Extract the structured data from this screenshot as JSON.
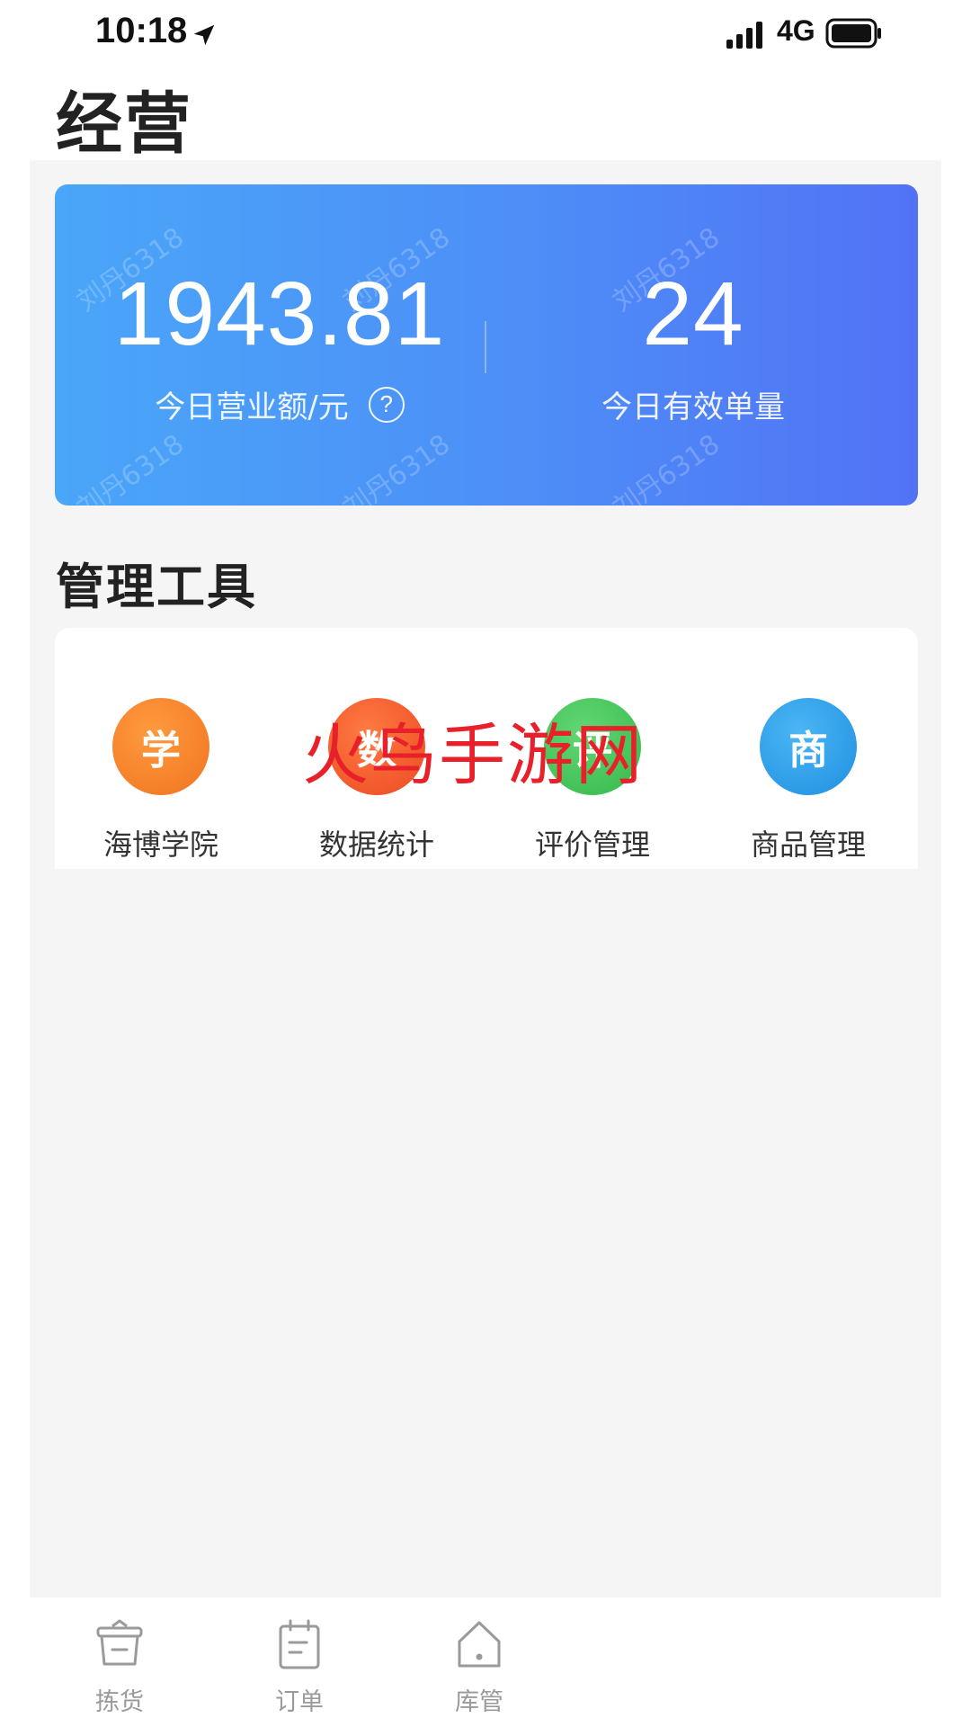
{
  "status_bar": {
    "time": "10:18",
    "network": "4G",
    "icons": [
      "location-arrow-icon",
      "signal-icon",
      "battery-icon"
    ]
  },
  "page": {
    "title": "经营"
  },
  "summary": {
    "revenue_value": "1943.81",
    "revenue_label": "今日营业额/元",
    "help_glyph": "?",
    "orders_value": "24",
    "orders_label": "今日有效单量",
    "watermark": "刘丹6318",
    "gradient_colors": [
      "#4aa6f8",
      "#5272f6"
    ]
  },
  "tools_section": {
    "title": "管理工具",
    "tools": [
      {
        "glyph": "学",
        "label": "海博学院",
        "color": "#f6852a",
        "icon": "academy-icon"
      },
      {
        "glyph": "数",
        "label": "数据统计",
        "color": "#f0582c",
        "icon": "data-icon"
      },
      {
        "glyph": "评",
        "label": "评价管理",
        "color": "#46c45a",
        "icon": "review-icon"
      },
      {
        "glyph": "商",
        "label": "商品管理",
        "color": "#2c9fe8",
        "icon": "goods-icon"
      }
    ]
  },
  "overlay_text": "火鸟手游网",
  "bottom_nav": {
    "items": [
      {
        "label": "拣货",
        "icon": "basket-icon"
      },
      {
        "label": "订单",
        "icon": "clipboard-icon"
      },
      {
        "label": "库管",
        "icon": "home-icon"
      }
    ]
  }
}
